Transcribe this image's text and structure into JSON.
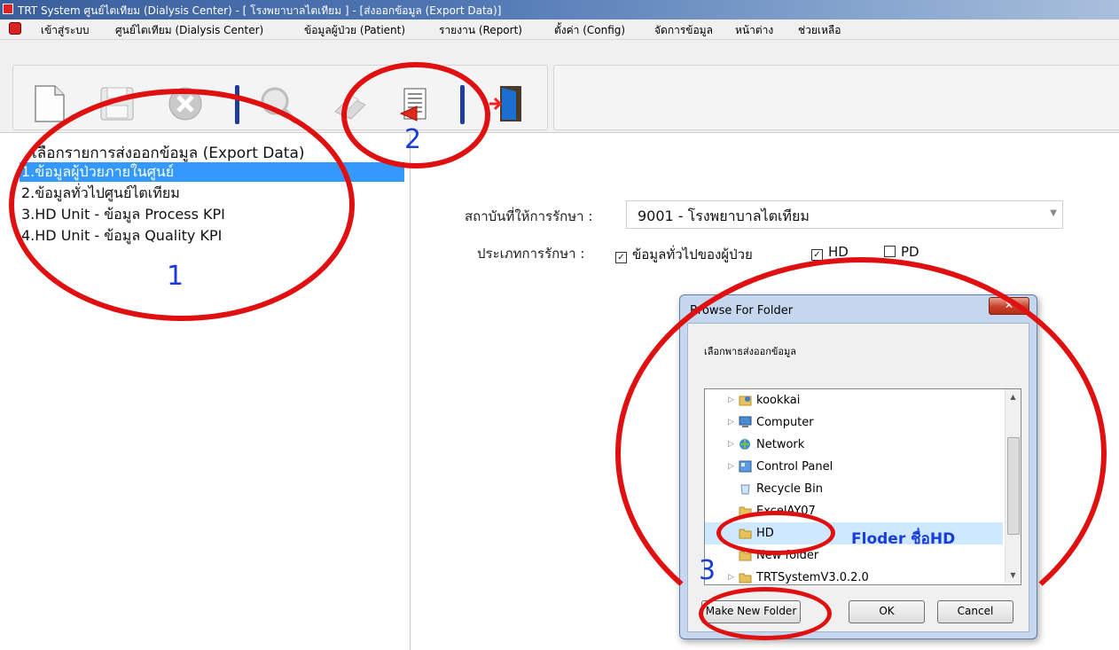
{
  "window": {
    "title": "TRT System ศูนย์ไตเทียม (Dialysis Center) - [ โรงพยาบาลไตเทียม ] - [ส่งออกข้อมูล (Export Data)]"
  },
  "menu": {
    "items": [
      "เข้าสู่ระบบ",
      "ศูนย์ไตเทียม (Dialysis Center)",
      "ข้อมูลผู้ป่วย (Patient)",
      "รายงาน (Report)",
      "ตั้งค่า (Config)",
      "จัดการข้อมูล",
      "หน้าต่าง",
      "ช่วยเหลือ"
    ]
  },
  "toolbar": {
    "icons": [
      "new-icon",
      "save-icon",
      "delete-icon",
      "search-icon",
      "print-icon",
      "export-icon",
      "exit-icon"
    ]
  },
  "left_panel": {
    "heading": "เลือกรายการส่งออกข้อมูล (Export Data)",
    "items": [
      "1.ข้อมูลผู้ป่วยภายในศูนย์",
      "2.ข้อมูลทั่วไปศูนย์ไตเทียม",
      "3.HD Unit - ข้อมูล Process KPI",
      "4.HD Unit - ข้อมูล Quality KPI"
    ],
    "selected_index": 0
  },
  "form": {
    "institution_label": "สถาบันที่ให้การรักษา :",
    "institution_value": "9001 - โรงพยาบาลไตเทียม",
    "treatment_label": "ประเภทการรักษา :",
    "options": [
      {
        "label": "ข้อมูลทั่วไปของผู้ป่วย",
        "checked": true
      },
      {
        "label": "HD",
        "checked": true
      },
      {
        "label": "PD",
        "checked": false
      }
    ]
  },
  "dialog": {
    "title": "Browse For Folder",
    "instruction": "เลือกพาธส่งออกข้อมูล",
    "tree": [
      "kookkai",
      "Computer",
      "Network",
      "Control Panel",
      "Recycle Bin",
      "ExcelAY07",
      "HD",
      "New folder",
      "TRTSystemV3.0.2.0"
    ],
    "selected": "HD",
    "buttons": {
      "new_folder": "Make New Folder",
      "ok": "OK",
      "cancel": "Cancel"
    }
  },
  "annotations": {
    "n1": "1",
    "n2": "2",
    "n3": "3",
    "note": "Floder ชื่อHD",
    "color": "#e01010"
  }
}
